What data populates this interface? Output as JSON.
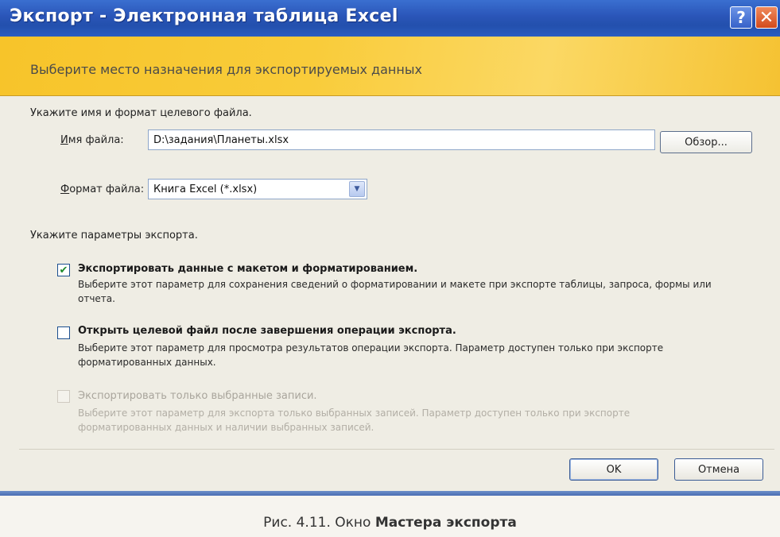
{
  "window": {
    "title": "Экспорт - Электронная таблица Excel",
    "help_label": "?",
    "close_label": "✕"
  },
  "banner": {
    "heading": "Выберите место назначения для экспортируемых данных"
  },
  "file_section": {
    "label": "Укажите имя и формат целевого файла.",
    "filename_label_underlined": "И",
    "filename_label_rest": "мя файла:",
    "filename_value": "D:\\задания\\Планеты.xlsx",
    "browse_label": "Обзор...",
    "format_label_underlined": "Ф",
    "format_label_rest": "ормат файла:",
    "format_value": "Книга Excel (*.xlsx)"
  },
  "options_section": {
    "label": "Укажите параметры экспорта.",
    "options": [
      {
        "title": "Экспортировать данные с макетом и форматированием.",
        "description": "Выберите этот параметр для сохранения сведений о форматировании и макете при экспорте таблицы, запроса, формы или отчета.",
        "checked": true,
        "enabled": true
      },
      {
        "title": "Открыть целевой файл после завершения операции экспорта.",
        "description": "Выберите этот параметр для просмотра результатов операции экспорта. Параметр доступен только при экспорте форматированных данных.",
        "checked": false,
        "enabled": true
      },
      {
        "title": "Экспортировать только выбранные записи.",
        "description": "Выберите этот параметр для экспорта только выбранных записей. Параметр доступен только при экспорте форматированных данных и наличии выбранных записей.",
        "checked": false,
        "enabled": false
      }
    ]
  },
  "buttons": {
    "ok": "OK",
    "cancel": "Отмена"
  },
  "caption": {
    "prefix": "Рис. 4.11. Окно ",
    "bold": "Мастера экспорта"
  },
  "colors": {
    "titlebar": "#2a55b8",
    "banner": "#f9cc3a",
    "check": "#1d8a2a"
  }
}
